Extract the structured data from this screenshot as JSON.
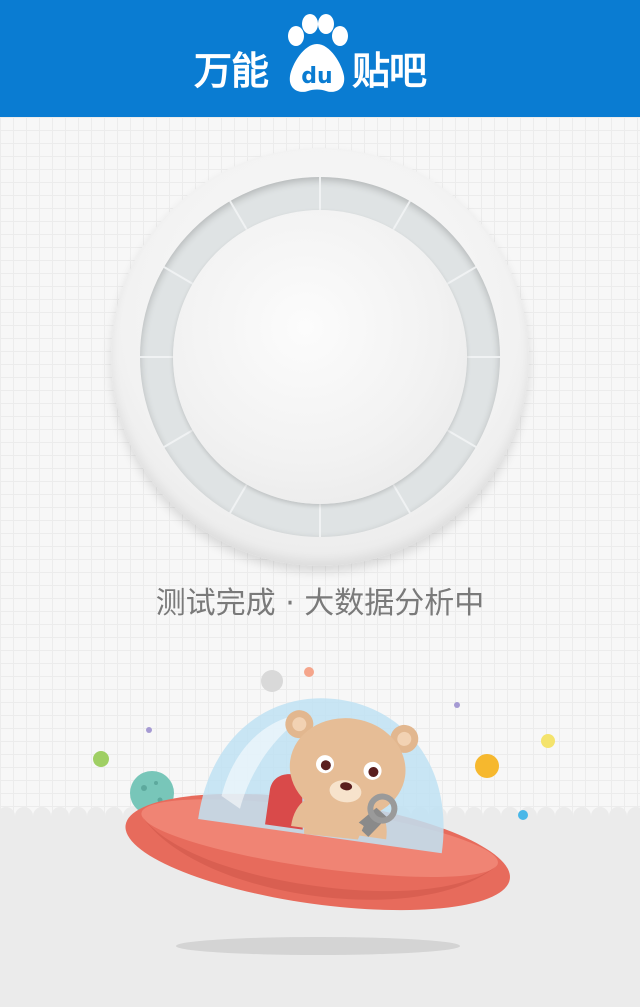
{
  "header": {
    "logo_left_text": "万能",
    "logo_paw_text": "du",
    "logo_right_text": "贴吧",
    "background_color": "#0a7cd2"
  },
  "status": {
    "text": "测试完成 · 大数据分析中"
  },
  "icons": {
    "logo_paw": "paw-icon",
    "dial": "dial-icon",
    "illustration": "bear-ufo-illustration"
  }
}
